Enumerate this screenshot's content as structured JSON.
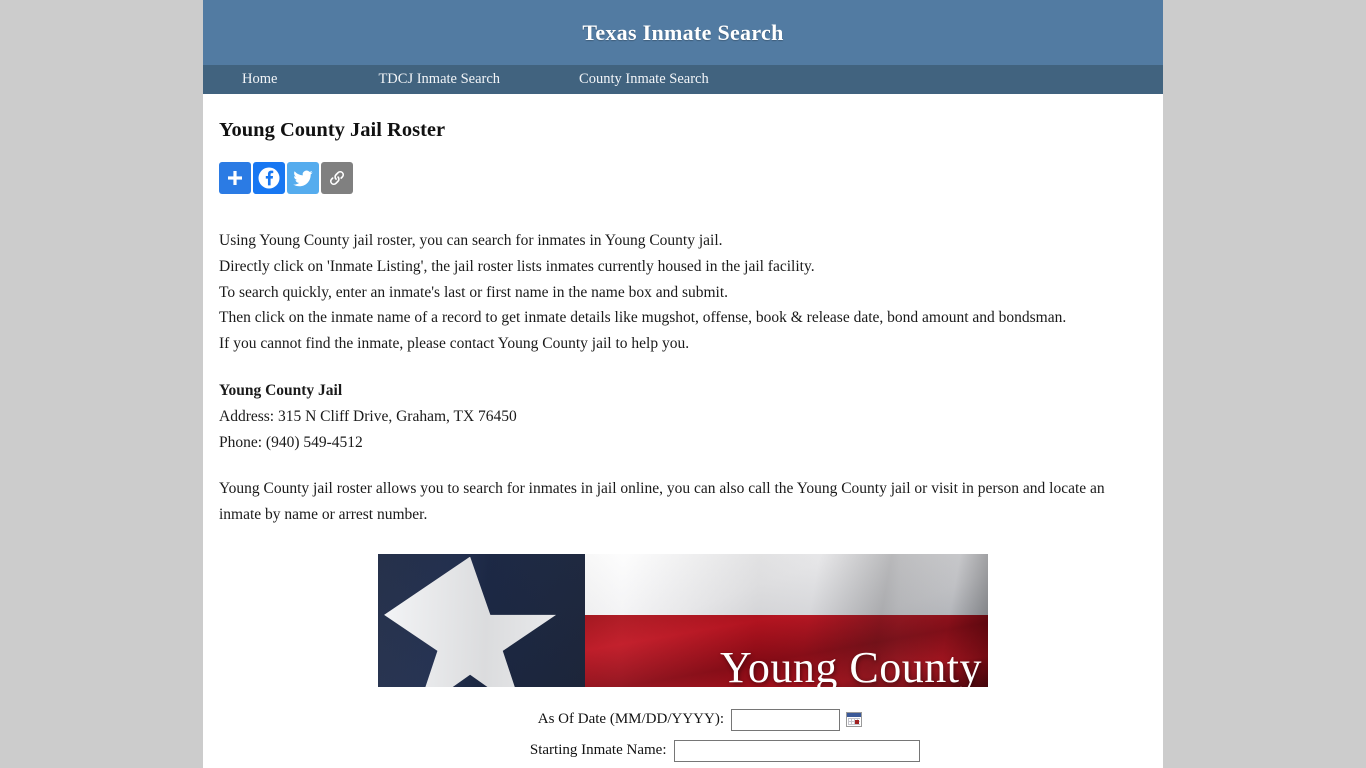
{
  "site": {
    "title": "Texas Inmate Search",
    "header_bg": "#527ba2",
    "nav_bg": "#41637f"
  },
  "nav": {
    "home": "Home",
    "tdcj": "TDCJ Inmate Search",
    "county": "County Inmate Search"
  },
  "page": {
    "title": "Young County Jail Roster"
  },
  "share": {
    "addthis_label": "Share",
    "facebook_label": "Facebook",
    "twitter_label": "Twitter",
    "link_label": "Copy Link",
    "colors": {
      "addthis": "#2b7be4",
      "facebook": "#1877f2",
      "twitter": "#55acee",
      "link": "#808080"
    }
  },
  "intro": {
    "line1": "Using Young County jail roster, you can search for inmates in Young County jail.",
    "line2": "Directly click on 'Inmate Listing', the jail roster lists inmates currently housed in the jail facility.",
    "line3": "To search quickly, enter an inmate's last or first name in the name box and submit.",
    "line4": "Then click on the inmate name of a record to get inmate details like mugshot, offense, book & release date, bond amount and bondsman.",
    "line5": "If you cannot find the inmate, please contact Young County jail to help you."
  },
  "jail": {
    "name": "Young County Jail",
    "address": "Address: 315 N Cliff Drive, Graham, TX 76450",
    "phone": "Phone: (940) 549-4512"
  },
  "closing": {
    "text": "Young County jail roster allows you to search for inmates in jail online, you can also call the Young County jail or visit in person and locate an inmate by name or arrest number."
  },
  "banner": {
    "caption": "Young County",
    "alt": "Texas flag with Young County caption"
  },
  "form": {
    "date_label": "As Of Date (MM/DD/YYYY):",
    "date_value": "",
    "date_placeholder": "",
    "name_label": "Starting Inmate Name:",
    "name_value": "",
    "name_placeholder": ""
  }
}
